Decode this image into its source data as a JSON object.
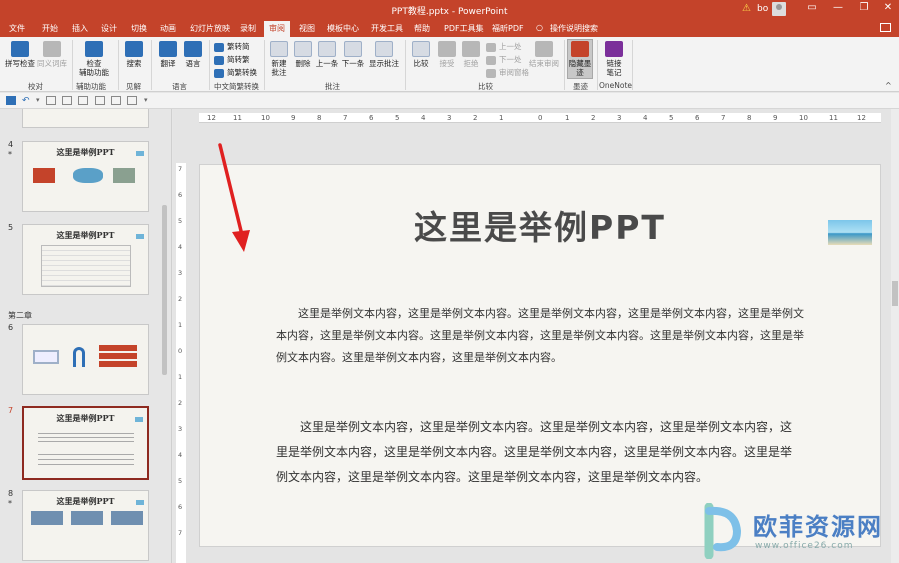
{
  "titlebar": {
    "title": "PPT教程.pptx - PowerPoint",
    "user": "bo",
    "minimize": "—",
    "restore": "❐",
    "close": "✕"
  },
  "tabs": [
    "文件",
    "开始",
    "插入",
    "设计",
    "切换",
    "动画",
    "幻灯片放映",
    "录制",
    "审阅",
    "视图",
    "模板中心",
    "开发工具",
    "帮助",
    "PDF工具集",
    "福昕PDF",
    "操作说明搜索"
  ],
  "ribbon": {
    "spell": "拼写检查",
    "thesaurus": "同义词库",
    "check_access_1": "检查",
    "check_access_2": "辅助功能",
    "search": "搜索",
    "translate": "翻译",
    "language": "语言",
    "trad_to_simp": "繁转简",
    "simp_to_trad": "简转繁",
    "simp_trad_convert": "简繁转换",
    "new_comment_1": "新建",
    "new_comment_2": "批注",
    "delete": "删除",
    "previous": "上一条",
    "next": "下一条",
    "show_comments": "显示批注",
    "compare": "比较",
    "accept": "接受",
    "reject": "拒绝",
    "prev_change": "上一处",
    "next_change": "下一处",
    "reviewing_pane": "审阅窗格",
    "end_review": "结束审阅",
    "hide_ink_1": "隐藏墨",
    "hide_ink_2": "迹",
    "linked_notes_1": "链接",
    "linked_notes_2": "笔记",
    "groups": {
      "proofing": "校对",
      "accessibility": "辅助功能",
      "insights": "见解",
      "language": "语言",
      "chinese_conversion": "中文简繁转换",
      "comments": "批注",
      "compare": "比较",
      "ink": "墨迹",
      "onenote": "OneNote"
    }
  },
  "thumbnails": {
    "section_label": "第二章",
    "slides": [
      {
        "num": "4",
        "star": "*",
        "title": "这里是举例PPT"
      },
      {
        "num": "5",
        "star": "",
        "title": "这里是举例PPT"
      },
      {
        "num": "6",
        "star": "",
        "title": ""
      },
      {
        "num": "7",
        "star": "",
        "title": "这里是举例PPT"
      },
      {
        "num": "8",
        "star": "*",
        "title": "这里是举例PPT"
      }
    ]
  },
  "ruler": {
    "h": [
      "12",
      "11",
      "10",
      "9",
      "8",
      "7",
      "6",
      "5",
      "4",
      "3",
      "2",
      "1",
      "0",
      "1",
      "2",
      "3",
      "4",
      "5",
      "6",
      "7",
      "8",
      "9",
      "10",
      "11",
      "12"
    ],
    "v": [
      "7",
      "6",
      "5",
      "4",
      "3",
      "2",
      "1",
      "0",
      "1",
      "2",
      "3",
      "4",
      "5",
      "6",
      "7"
    ]
  },
  "slide": {
    "title": "这里是举例PPT",
    "para1": "这里是举例文本内容，这里是举例文本内容。这里是举例文本内容，这里是举例文本内容，这里是举例文本内容，这里是举例文本内容。这里是举例文本内容，这里是举例文本内容。这里是举例文本内容，这里是举例文本内容。这里是举例文本内容，这里是举例文本内容。",
    "para2": "这里是举例文本内容，这里是举例文本内容。这里是举例文本内容，这里是举例文本内容，这里是举例文本内容，这里是举例文本内容。这里是举例文本内容，这里是举例文本内容。这里是举例文本内容，这里是举例文本内容。这里是举例文本内容，这里是举例文本内容。"
  },
  "watermark": {
    "text": "欧菲资源网",
    "url": "www.office26.com"
  },
  "colors": {
    "accent": "#c4432a",
    "selected_thumb_border": "#8e2a20",
    "arrow": "#e02020"
  }
}
